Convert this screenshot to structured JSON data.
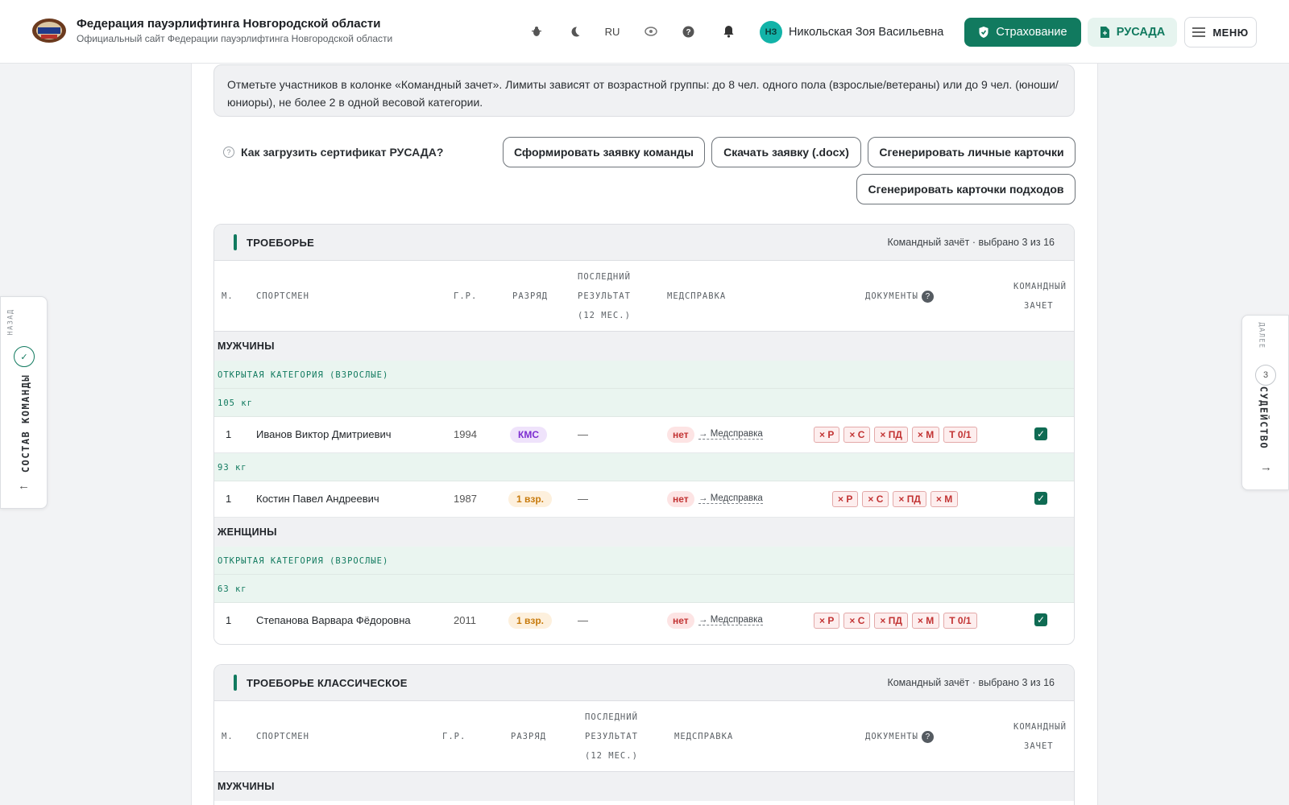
{
  "header": {
    "title": "Федерация пауэрлифтинга Новгородской области",
    "subtitle": "Официальный сайт Федерации пауэрлифтинга Новгородской области",
    "lang": "RU",
    "user_initials": "НЗ",
    "user_name": "Никольская Зоя Васильевна",
    "insurance_label": "Страхование",
    "rusada_label": "РУСАДА",
    "menu_label": "МЕНЮ"
  },
  "note": "Отметьте участников в колонке «Командный зачет». Лимиты зависят от возрастной группы: до 8 чел. одного пола (взрослые/ветераны) или до 9 чел. (юноши/юниоры), не более 2 в одной весовой категории.",
  "help_link": "Как загрузить сертификат РУСАДА?",
  "actions": {
    "form_team": "Сформировать заявку команды",
    "download": "Скачать заявку (.docx)",
    "personal_cards": "Сгенерировать личные карточки",
    "attempt_cards": "Сгенерировать карточки подходов"
  },
  "columns": {
    "place": "М.",
    "athlete": "СПОРТСМЕН",
    "birth": "Г.Р.",
    "rank": "РАЗРЯД",
    "last1": "ПОСЛЕДНИЙ",
    "last2": "РЕЗУЛЬТАТ",
    "last3": "(12 МЕС.)",
    "med": "МЕДСПРАВКА",
    "docs": "ДОКУМЕНТЫ",
    "team1": "КОМАНДНЫЙ",
    "team2": "ЗАЧЕТ"
  },
  "sections": [
    {
      "title": "ТРОЕБОРЬЕ",
      "meta": "Командный зачёт · выбрано 3 из 16",
      "men": "МУЖЧИНЫ",
      "women": "ЖЕНЩИНЫ",
      "cat_open": "ОТКРЫТАЯ КАТЕГОРИЯ (ВЗРОСЛЫЕ)",
      "w105": "105 кг",
      "w93": "93 кг",
      "w63": "63 кг",
      "athletes": [
        {
          "place": "1",
          "name": "Иванов Виктор Дмитриевич",
          "year": "1994",
          "rank": "КМС",
          "last": "—",
          "med": "нет",
          "med_link": "→ Медсправка",
          "docs": [
            "× Р",
            "× С",
            "× ПД",
            "× М",
            "Т 0/1"
          ]
        },
        {
          "place": "1",
          "name": "Костин Павел Андреевич",
          "year": "1987",
          "rank": "1 взр.",
          "last": "—",
          "med": "нет",
          "med_link": "→ Медсправка",
          "docs": [
            "× Р",
            "× С",
            "× ПД",
            "× М"
          ]
        },
        {
          "place": "1",
          "name": "Степанова Варвара Фёдоровна",
          "year": "2011",
          "rank": "1 взр.",
          "last": "—",
          "med": "нет",
          "med_link": "→ Медсправка",
          "docs": [
            "× Р",
            "× С",
            "× ПД",
            "× М",
            "Т 0/1"
          ]
        }
      ]
    },
    {
      "title": "ТРОЕБОРЬЕ КЛАССИЧЕСКОЕ",
      "meta": "Командный зачёт · выбрано 3 из 16",
      "men": "МУЖЧИНЫ"
    }
  ],
  "rail_left": {
    "back": "НАЗАД",
    "label": "СОСТАВ КОМАНДЫ"
  },
  "rail_right": {
    "next": "ДАЛЕЕ",
    "step": "3",
    "label": "СУДЕЙСТВО"
  },
  "colors": {
    "accent": "#117a5f",
    "danger": "#c23333"
  }
}
